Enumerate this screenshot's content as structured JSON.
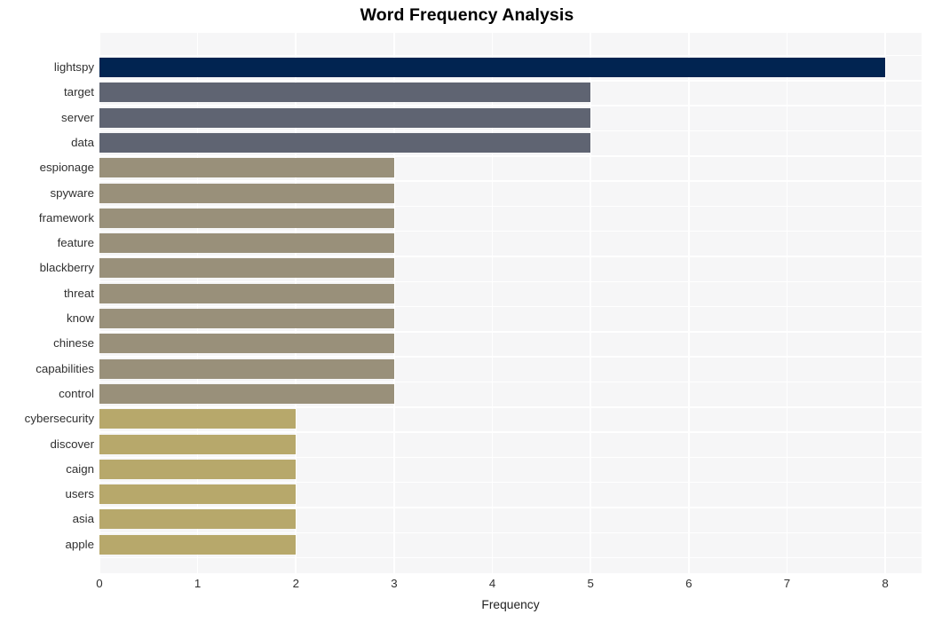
{
  "chart_data": {
    "type": "bar",
    "orientation": "horizontal",
    "title": "Word Frequency Analysis",
    "xlabel": "Frequency",
    "ylabel": "",
    "xlim": [
      0,
      8.37
    ],
    "xticks": [
      0,
      1,
      2,
      3,
      4,
      5,
      6,
      7,
      8
    ],
    "xtick_labels": [
      "0",
      "1",
      "2",
      "3",
      "4",
      "5",
      "6",
      "7",
      "8"
    ],
    "grid": true,
    "grid_color": "#ffffff",
    "legend": null,
    "plot_background": "#f6f6f7",
    "figure_background": "#ffffff",
    "categories": [
      "lightspy",
      "target",
      "server",
      "data",
      "espionage",
      "spyware",
      "framework",
      "feature",
      "blackberry",
      "threat",
      "know",
      "chinese",
      "capabilities",
      "control",
      "cybersecurity",
      "discover",
      "caign",
      "users",
      "asia",
      "apple"
    ],
    "values": [
      8,
      5,
      5,
      5,
      3,
      3,
      3,
      3,
      3,
      3,
      3,
      3,
      3,
      3,
      2,
      2,
      2,
      2,
      2,
      2
    ],
    "bar_colors": [
      "#012451",
      "#5f6472",
      "#5f6472",
      "#5f6472",
      "#99907a",
      "#99907a",
      "#99907a",
      "#99907a",
      "#99907a",
      "#99907a",
      "#99907a",
      "#99907a",
      "#99907a",
      "#99907a",
      "#b7a86b",
      "#b7a86b",
      "#b7a86b",
      "#b7a86b",
      "#b7a86b",
      "#b7a86b"
    ],
    "bars": [
      {
        "label": "lightspy",
        "value": 8,
        "color": "#012451"
      },
      {
        "label": "target",
        "value": 5,
        "color": "#5f6472"
      },
      {
        "label": "server",
        "value": 5,
        "color": "#5f6472"
      },
      {
        "label": "data",
        "value": 5,
        "color": "#5f6472"
      },
      {
        "label": "espionage",
        "value": 3,
        "color": "#99907a"
      },
      {
        "label": "spyware",
        "value": 3,
        "color": "#99907a"
      },
      {
        "label": "framework",
        "value": 3,
        "color": "#99907a"
      },
      {
        "label": "feature",
        "value": 3,
        "color": "#99907a"
      },
      {
        "label": "blackberry",
        "value": 3,
        "color": "#99907a"
      },
      {
        "label": "threat",
        "value": 3,
        "color": "#99907a"
      },
      {
        "label": "know",
        "value": 3,
        "color": "#99907a"
      },
      {
        "label": "chinese",
        "value": 3,
        "color": "#99907a"
      },
      {
        "label": "capabilities",
        "value": 3,
        "color": "#99907a"
      },
      {
        "label": "control",
        "value": 3,
        "color": "#99907a"
      },
      {
        "label": "cybersecurity",
        "value": 2,
        "color": "#b7a86b"
      },
      {
        "label": "discover",
        "value": 2,
        "color": "#b7a86b"
      },
      {
        "label": "caign",
        "value": 2,
        "color": "#b7a86b"
      },
      {
        "label": "users",
        "value": 2,
        "color": "#b7a86b"
      },
      {
        "label": "asia",
        "value": 2,
        "color": "#b7a86b"
      },
      {
        "label": "apple",
        "value": 2,
        "color": "#b7a86b"
      }
    ]
  }
}
